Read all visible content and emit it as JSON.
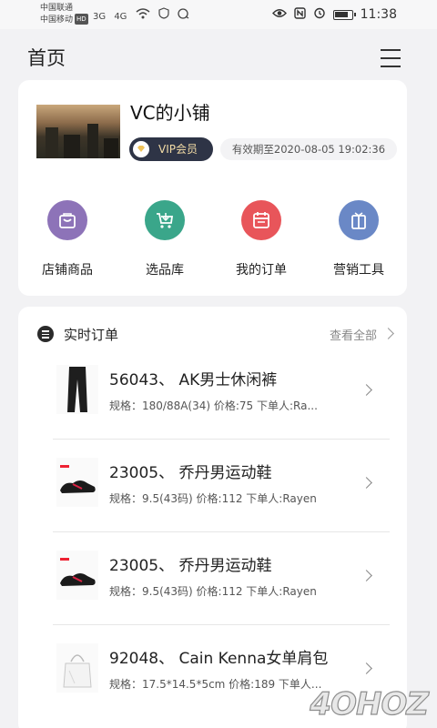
{
  "status_bar": {
    "carrier_1": "中国联通",
    "carrier_2": "中国移动",
    "hd_badge": "HD",
    "net_1": "3G",
    "net_2": "4G",
    "time": "11:38",
    "battery_level": 0.8
  },
  "header": {
    "title": "首页"
  },
  "shop": {
    "name": "VC的小铺",
    "vip_label": "VIP会员",
    "expiry": "有效期至2020-08-05 19:02:36"
  },
  "quick_actions": [
    {
      "label": "店铺商品",
      "icon": "shopping-bag-icon",
      "color": "#8d73b8"
    },
    {
      "label": "选品库",
      "icon": "cart-icon",
      "color": "#3aa68a"
    },
    {
      "label": "我的订单",
      "icon": "calendar-icon",
      "color": "#e8555a"
    },
    {
      "label": "营销工具",
      "icon": "gift-icon",
      "color": "#6a88c6"
    }
  ],
  "orders": {
    "title": "实时订单",
    "view_all": "查看全部",
    "items": [
      {
        "name": "56043、 AK男士休闲裤",
        "spec": "规格：180/88A(34) 价格:75 下单人:Ra..."
      },
      {
        "name": "23005、 乔丹男运动鞋",
        "spec": "规格：9.5(43码) 价格:112 下单人:Rayen"
      },
      {
        "name": "23005、 乔丹男运动鞋",
        "spec": "规格：9.5(43码) 价格:112 下单人:Rayen"
      },
      {
        "name": "92048、 Cain Kenna女单肩包",
        "spec": "规格：17.5*14.5*5cm 价格:189 下单人..."
      }
    ]
  },
  "watermark": "4OHOZ"
}
